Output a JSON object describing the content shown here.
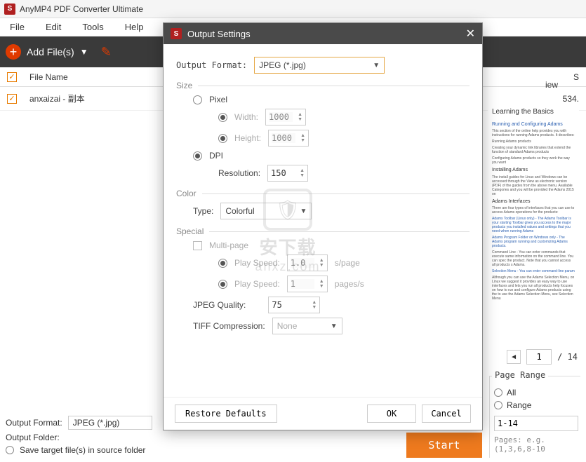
{
  "app": {
    "title": "AnyMP4 PDF Converter Ultimate"
  },
  "menu": {
    "file": "File",
    "edit": "Edit",
    "tools": "Tools",
    "help": "Help"
  },
  "toolbar": {
    "add_files": "Add File(s)"
  },
  "list": {
    "header_check": "✓",
    "header_filename": "File Name",
    "header_size": "S",
    "rows": [
      {
        "check": "✓",
        "name": "anxaizai - 副本",
        "size": "534."
      }
    ],
    "preview_label": "iew"
  },
  "preview": {
    "h1": "Learning the Basics",
    "h2": "Running and Configuring Adams",
    "body1": "This section of the online help provides you with instructions for running Adams products. It describes:",
    "li1": "Running Adams products",
    "li2": "Creating your dynamic link libraries that extend the function of standard Adams products",
    "li3": "Configuring Adams products so they work the way you want",
    "h3": "Installing Adams",
    "body2": "The install guides for Linux and Windows can be accessed through the View as electronic version (PDF) of the guides from the above menu. Available Categories and you will be provided the Adams 2015 on",
    "h4": "Adams Interfaces",
    "body3": "There are four types of interfaces that you can use to access Adams operations for the products:",
    "li4": "Adams Toolbar (Linux only) - The Adams Toolbar is your starting Toolbar gives you access to the major products you installed values and settings that you need when running Adams",
    "li5": "Adams Program Folder on Windows only - The Adams program running and customizing Adams products.",
    "li6": "Command Line - You can enter commands that execute same information on the command line. You can spec the product. Note that you cannot access all products s Adams.",
    "li7": "Selection Menu - You can enter command-line param",
    "body4": "Although you can use the Adams Selection Menu, on Linux we suggest it provides an easy way to use interfaces and lets you run all products help focuses on how to run and configure Adams products using the to use the Adams Selection Menu, see Selection Menu"
  },
  "page_nav": {
    "current": "1",
    "total": "/ 14"
  },
  "page_range": {
    "label": "Page Range",
    "all": "All",
    "range": "Range",
    "range_value": "1-14",
    "hint": "Pages: e.g.(1,3,6,8-10"
  },
  "bottom": {
    "output_format_label": "Output Format:",
    "output_format_value": "JPEG (*.jpg)",
    "output_folder_label": "Output Folder:",
    "save_source": "Save target file(s) in source folder",
    "start": "Start"
  },
  "modal": {
    "title": "Output Settings",
    "output_format_label": "Output Format:",
    "output_format_value": "JPEG (*.jpg)",
    "size_label": "Size",
    "pixel_label": "Pixel",
    "width_label": "Width:",
    "width_value": "1000",
    "height_label": "Height:",
    "height_value": "1000",
    "dpi_label": "DPI",
    "resolution_label": "Resolution:",
    "resolution_value": "150",
    "color_label": "Color",
    "type_label": "Type:",
    "type_value": "Colorful",
    "special_label": "Special",
    "multipage_label": "Multi-page",
    "playspeed1_label": "Play Speed:",
    "playspeed1_value": "1.0",
    "playspeed1_unit": "s/page",
    "playspeed2_label": "Play Speed:",
    "playspeed2_value": "1",
    "playspeed2_unit": "pages/s",
    "jpeg_quality_label": "JPEG Quality:",
    "jpeg_quality_value": "75",
    "tiff_label": "TIFF Compression:",
    "tiff_value": "None",
    "restore": "Restore Defaults",
    "ok": "OK",
    "cancel": "Cancel"
  },
  "watermark": {
    "chars": "安下载",
    "url": "anxz.com"
  }
}
